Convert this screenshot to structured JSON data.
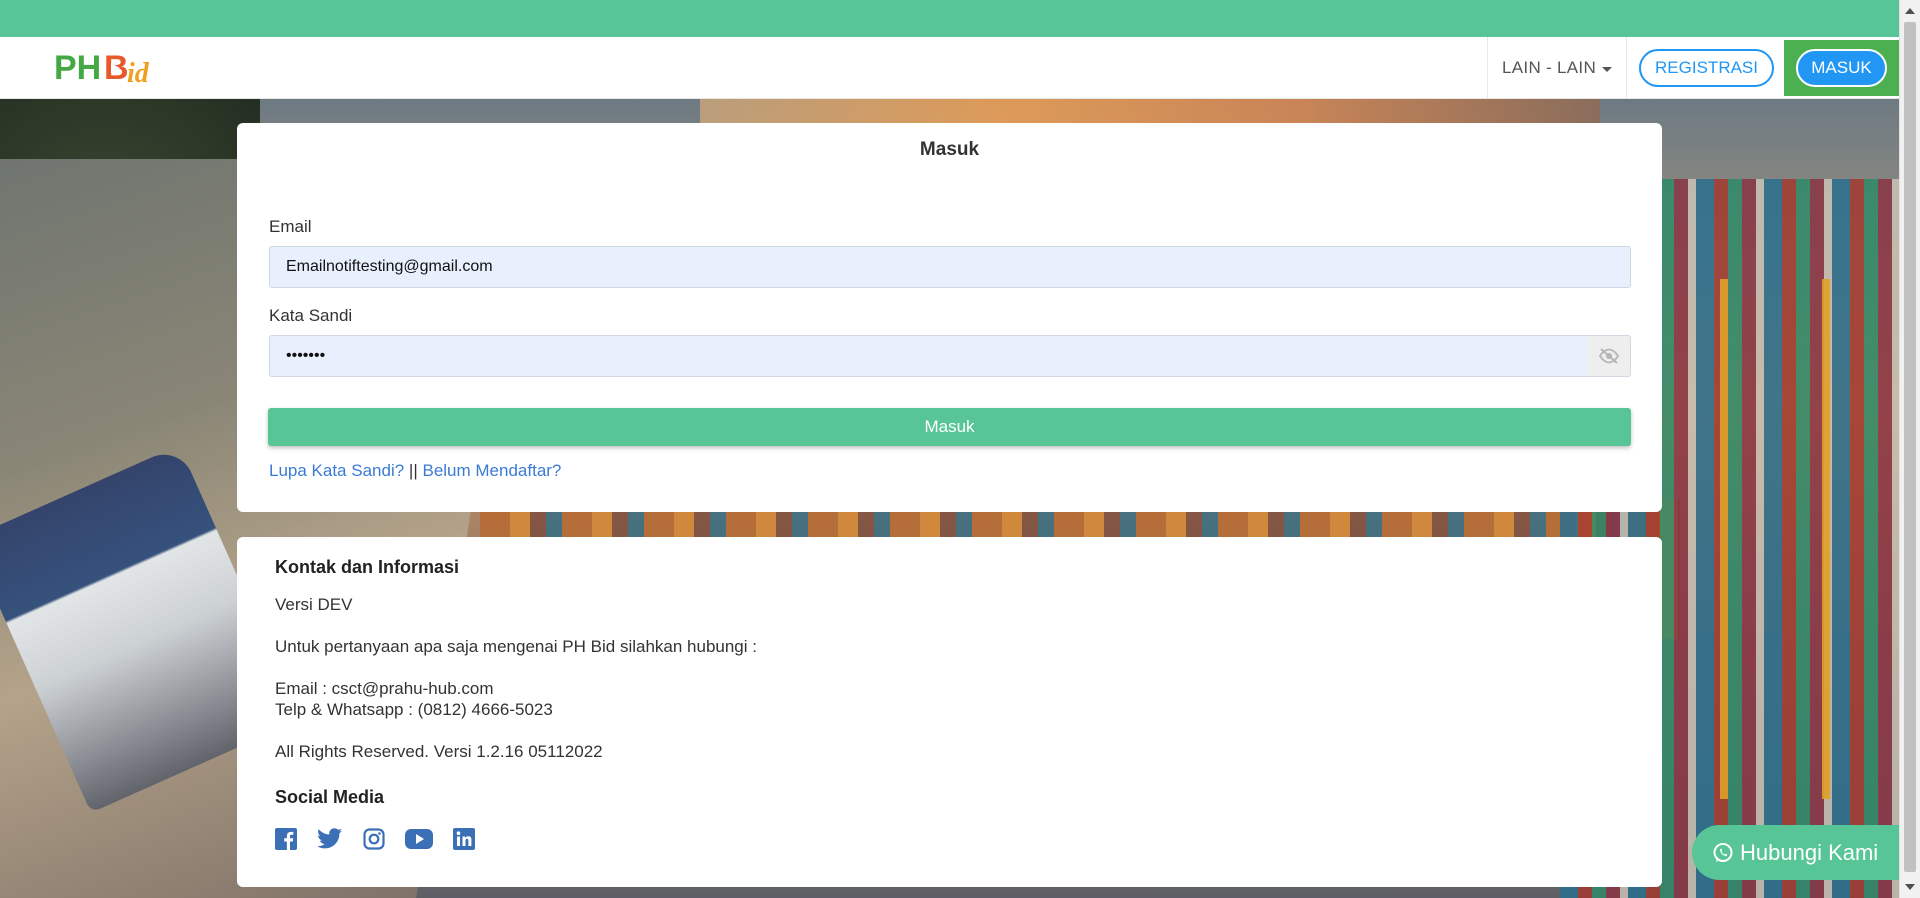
{
  "brand": {
    "logo_text_ph": "PH",
    "logo_text_b": "B",
    "logo_text_id": "id"
  },
  "navbar": {
    "dropdown_label": "LAIN - LAIN",
    "register_label": "REGISTRASI",
    "login_label": "MASUK"
  },
  "login": {
    "title": "Masuk",
    "email_label": "Email",
    "email_value": "Emailnotiftesting@gmail.com",
    "password_label": "Kata Sandi",
    "password_value": "•••••••",
    "submit_label": "Masuk",
    "forgot_link": "Lupa Kata Sandi?",
    "separator": "||",
    "register_link": "Belum Mendaftar?"
  },
  "info": {
    "heading": "Kontak dan Informasi",
    "version_note": "Versi DEV",
    "intro": "Untuk pertanyaan apa saja mengenai PH Bid silahkan hubungi :",
    "email_line": "Email : csct@prahu-hub.com",
    "phone_line": "Telp & Whatsapp : (0812) 4666-5023",
    "rights": "All Rights Reserved. Versi 1.2.16 05112022",
    "social_heading": "Social Media",
    "social_icons": [
      "facebook-icon",
      "twitter-icon",
      "instagram-icon",
      "youtube-icon",
      "linkedin-icon"
    ]
  },
  "whatsapp_button": {
    "label": "Hubungi Kami"
  },
  "colors": {
    "primary_green": "#57c596",
    "link_blue": "#3a7bd5",
    "button_blue": "#2196f3",
    "social_blue": "#3b6fb6"
  }
}
